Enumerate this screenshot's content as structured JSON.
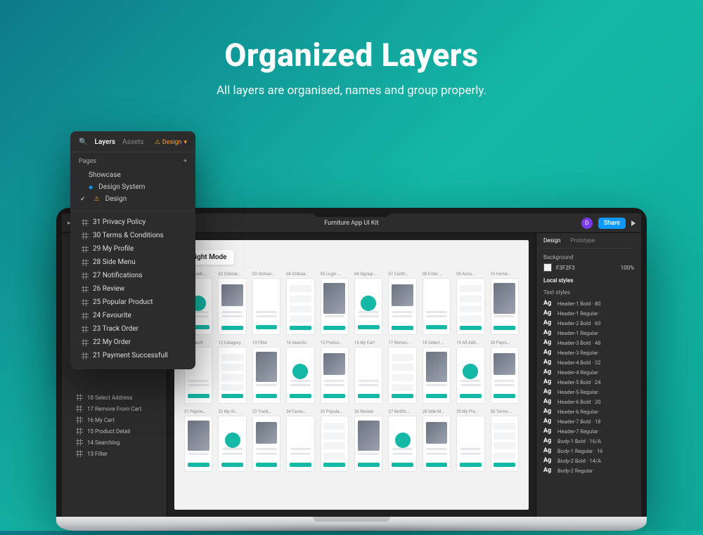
{
  "hero": {
    "title": "Organized Layers",
    "subtitle": "All layers are organised, names and group properly."
  },
  "layers_panel": {
    "tabs": {
      "layers": "Layers",
      "assets": "Assets",
      "design_tag": "Design"
    },
    "pages_label": "Pages",
    "pages": [
      {
        "label": "Showcase",
        "kind": "plain"
      },
      {
        "label": "Design System",
        "kind": "diamond"
      },
      {
        "label": "Design",
        "kind": "warn",
        "active": true
      }
    ],
    "frames": [
      "31 Privacy Policy",
      "30 Terms & Conditions",
      "29 My Profile",
      "28 Side Menu",
      "27 Notifications",
      "26 Review",
      "25 Popular Product",
      "24 Favourite",
      "23 Track Order",
      "22 My Order",
      "21 Payment Successfull"
    ]
  },
  "figma": {
    "file_title": "Furniture App UI Kit",
    "avatar_letter": "D",
    "share_label": "Share",
    "left_rail_items": [
      "18 Select Address",
      "17 Remove From Cart",
      "16 My Cart",
      "15 Product Detail",
      "14 Searching",
      "13 Filter"
    ],
    "mode_chip": "Light Mode",
    "artboards_row1": [
      "01 Splash …",
      "02 Onboar…",
      "03 Onboar…",
      "04 Onboar…",
      "05 Login …",
      "06 Signup…",
      "07 Confir…",
      "08 Enter …",
      "09 Acco…",
      "10 Home…"
    ],
    "artboards_row2": [
      "11 Search",
      "12 Category",
      "13 Filter",
      "14 Searchi…",
      "15 Produc…",
      "16 My Cart",
      "17 Remov…",
      "18 Select …",
      "19 All Add…",
      "20 Paym…"
    ],
    "artboards_row3": [
      "21 Payme…",
      "22 My Or…",
      "23 Track…",
      "24 Favou…",
      "25 Popula…",
      "26 Review",
      "27 Notific…",
      "28 Side M…",
      "29 My Pro…",
      "30 Terms …"
    ],
    "right_rail": {
      "tabs": {
        "design": "Design",
        "prototype": "Prototype"
      },
      "background_label": "Background",
      "background_value": "F3F2F3",
      "background_opacity": "100%",
      "local_styles_label": "Local styles",
      "text_styles_label": "Text styles",
      "styles": [
        "Header-1 Bold · 80",
        "Header-1 Regular ·",
        "Header-2 Bold · 60",
        "Header-1 Regular ·",
        "Header-3 Bold · 48",
        "Header-3 Regular ·",
        "Header-4 Bold · 32",
        "Header-4 Regular ·",
        "Header-5 Bold · 24",
        "Header-5 Regular ·",
        "Header-6 Bold · 20",
        "Header-6 Regular ·",
        "Header-7 Bold · 18",
        "Header-7 Regular ·",
        "Body-1 Bold · 16/A",
        "Body-1 Regular · 16",
        "Body-2 Bold · 14/A",
        "Body-2 Regular ·"
      ]
    }
  }
}
